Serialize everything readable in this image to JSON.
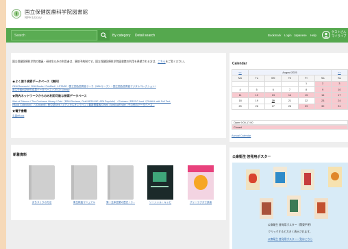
{
  "header": {
    "title": "国立保健医療科学院図書館",
    "subtitle": "NIPH Library"
  },
  "navbar": {
    "search_placeholder": "Search",
    "by_category": "By category",
    "detail_search": "Detail search",
    "bookmark": "Bookmark",
    "login": "Login",
    "japanese": "Japanese",
    "help": "Help",
    "user_line1": "ゲストさん",
    "user_line2": "マイライブ"
  },
  "notice": {
    "text": "国立保健医療科学院の職員・研修生以外の利用者は、事前予約制です。国立保健医療科学院図書館の利用を希望される方は、",
    "link": "こちら",
    "text_end": "をご覧ください。"
  },
  "databases": {
    "common_head": "★よく使う検索データベース（無料）",
    "common_line1": "CiNii Research / CiNii Books / PubMed / J-STAGE / 国立国会図書館サーチ（NDLサーチ） / 国立国会図書館デジタルコレクション /",
    "common_line2": "厚生労働科学研究成果データベース / OECD iLibrary",
    "network_head": "★院内ネットワークからのみ利用可能な検索データベース",
    "network_line1": "Web of Science / The Cochrane Library / Ovid（EBM Reviews, Ovid MEDLINE, APA PsycInfo） / Embase / EBSCO host（CINAHL with Full Text,",
    "network_line2": "eBook Collection） / JDreamⅢ / 医中誌Web / メディカルオンライン / 最新看護索引Web / MedicalFinder / その他のデータベース...",
    "ebook_head": "★電子書籍",
    "ebook_link": "丸善eBook"
  },
  "new_books": {
    "title": "新着資料",
    "items": [
      {
        "caption": "まちづくりの方法"
      },
      {
        "caption": "衛生検査マニュアル"
      },
      {
        "caption": "第一生命営業の歴史 / ラ..."
      },
      {
        "caption": "ソーシャル・キャピ"
      },
      {
        "caption": "ブリーラブズで読者"
      }
    ]
  },
  "calendar": {
    "title": "Calendar",
    "prev": "<<",
    "next": ">>",
    "month": "August 2025",
    "weekdays": [
      "Mo",
      "Tu",
      "We",
      "Th",
      "Fr",
      "Sa",
      "Su"
    ],
    "weeks": [
      [
        "28",
        "29",
        "30",
        "31",
        "1",
        "2",
        "3"
      ],
      [
        "4",
        "5",
        "6",
        "7",
        "8",
        "9",
        "10"
      ],
      [
        "11",
        "12",
        "13",
        "14",
        "15",
        "16",
        "17"
      ],
      [
        "18",
        "19",
        "20",
        "21",
        "22",
        "23",
        "24"
      ],
      [
        "25",
        "26",
        "27",
        "28",
        "29",
        "30",
        "31"
      ]
    ],
    "open_label": "Open 9:00-17:00",
    "closed_label": "Closed",
    "annual_link": "Annual Calendar",
    "closed_color": "#f8c9cf"
  },
  "posters": {
    "title": "公衆衛生 啓発用ポスター",
    "caption1": "公衆衛生 啓発用ポスター（関東不明）",
    "caption2": "クリックすると大きく表示されます。",
    "list_link": "公衆衛生 啓発用ポスター一覧はこちら"
  },
  "colors": {
    "navbar": "#55a84e",
    "link": "#3a6fb0",
    "poster_bg": "#d8ebf7"
  }
}
